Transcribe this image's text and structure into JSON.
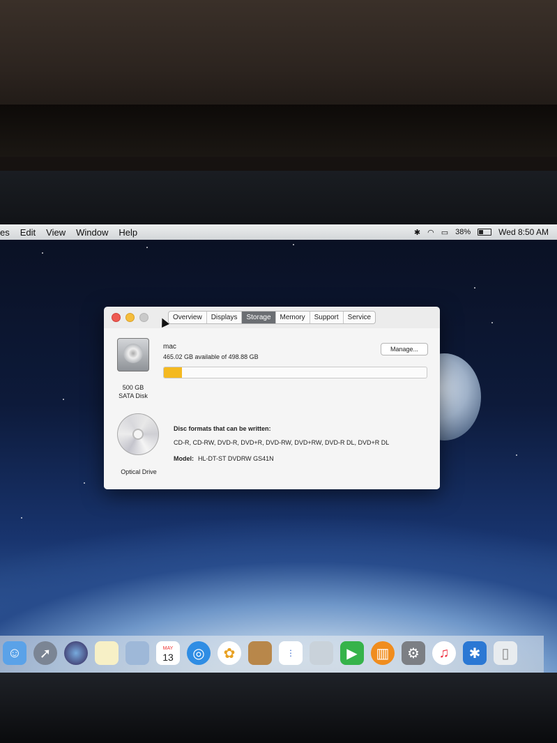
{
  "menubar": {
    "items": [
      "es",
      "Edit",
      "View",
      "Window",
      "Help"
    ],
    "battery": "38%",
    "clock": "Wed 8:50 AM"
  },
  "window": {
    "tabs": [
      "Overview",
      "Displays",
      "Storage",
      "Memory",
      "Support",
      "Service"
    ],
    "active_tab": "Storage",
    "disk": {
      "capacity_line": "500 GB",
      "type_line": "SATA Disk",
      "volume_name": "mac",
      "available_text": "465.02 GB available of 498.88 GB",
      "used_fraction": 0.07,
      "bar_color": "#f4b920",
      "manage_label": "Manage..."
    },
    "optical": {
      "label": "Optical Drive",
      "formats_heading": "Disc formats that can be written:",
      "formats": "CD-R, CD-RW, DVD-R, DVD+R, DVD-RW, DVD+RW, DVD-R DL, DVD+R DL",
      "model_label": "Model:",
      "model_value": "HL-DT-ST DVDRW GS41N"
    }
  },
  "dock": {
    "icons": [
      "finder-icon",
      "launchpad-icon",
      "siri-icon",
      "notes-icon",
      "preview-icon",
      "calendar-icon",
      "safari-icon",
      "photos-icon",
      "contacts-icon",
      "reminders-icon",
      "image-capture-icon",
      "facetime-icon",
      "ibooks-icon",
      "system-preferences-icon",
      "itunes-icon",
      "bluetooth-icon",
      "trash-icon"
    ],
    "calendar_month": "MAY",
    "calendar_day": "13"
  }
}
